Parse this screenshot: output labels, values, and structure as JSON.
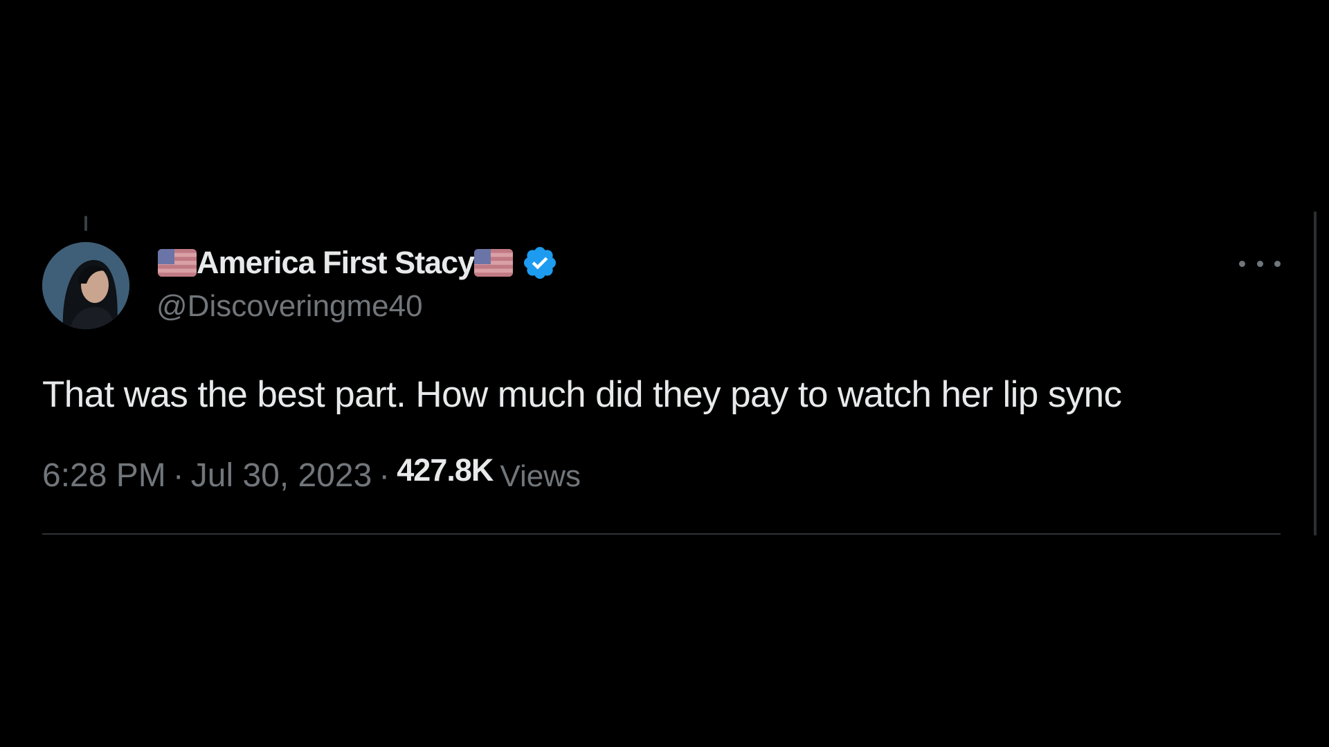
{
  "tweet": {
    "display_name": "America First Stacy",
    "handle": "@Discoveringme40",
    "text": "That was the best part. How much did they pay to watch her lip sync",
    "time": "6:28 PM",
    "separator": "·",
    "date": "Jul 30, 2023",
    "views_count": "427.8K",
    "views_label": "Views",
    "verified": true
  },
  "icons": {
    "flag_left": "us-flag-icon",
    "flag_right": "us-flag-icon",
    "verified": "verified-badge-icon",
    "more": "more-options-icon"
  },
  "colors": {
    "background": "#000000",
    "primary_text": "#e7e9ea",
    "secondary_text": "#71767b",
    "verified_blue": "#1d9bf0",
    "divider": "#2f3336"
  }
}
